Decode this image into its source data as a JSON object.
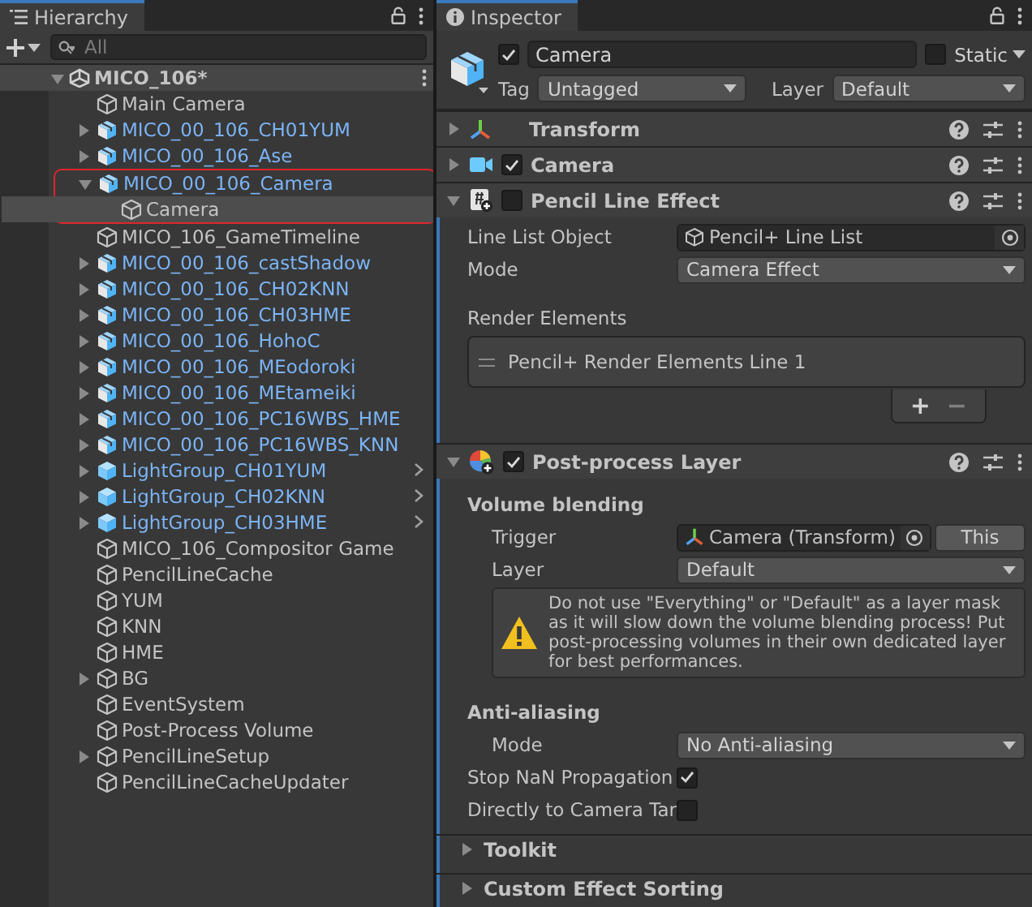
{
  "hierarchy": {
    "tab": "Hierarchy",
    "search": {
      "placeholder": "All"
    },
    "scene": {
      "name": "MICO_106*",
      "expanded": true,
      "children": [
        {
          "name": "Main Camera",
          "kind": "object",
          "selected": false
        },
        {
          "name": "MICO_00_106_CH01YUM",
          "kind": "model",
          "selected": false,
          "expanded": false
        },
        {
          "name": "MICO_00_106_Ase",
          "kind": "model",
          "selected": false,
          "expanded": false
        },
        {
          "name": "MICO_00_106_Camera",
          "kind": "model",
          "selected": false,
          "expanded": true,
          "outlined": true,
          "children": [
            {
              "name": "Camera",
              "kind": "object",
              "selected": true
            }
          ]
        },
        {
          "name": "MICO_106_GameTimeline",
          "kind": "object",
          "selected": false
        },
        {
          "name": "MICO_00_106_castShadow",
          "kind": "model",
          "selected": false,
          "expanded": false
        },
        {
          "name": "MICO_00_106_CH02KNN",
          "kind": "model",
          "selected": false,
          "expanded": false
        },
        {
          "name": "MICO_00_106_CH03HME",
          "kind": "model",
          "selected": false,
          "expanded": false
        },
        {
          "name": "MICO_00_106_HohoC",
          "kind": "model",
          "selected": false,
          "expanded": false
        },
        {
          "name": "MICO_00_106_MEodoroki",
          "kind": "model",
          "selected": false,
          "expanded": false
        },
        {
          "name": "MICO_00_106_MEtameiki",
          "kind": "model",
          "selected": false,
          "expanded": false
        },
        {
          "name": "MICO_00_106_PC16WBS_HME",
          "kind": "model",
          "selected": false,
          "expanded": false
        },
        {
          "name": "MICO_00_106_PC16WBS_KNN",
          "kind": "model",
          "selected": false,
          "expanded": false
        },
        {
          "name": "LightGroup_CH01YUM",
          "kind": "prefab",
          "selected": false,
          "expanded": false
        },
        {
          "name": "LightGroup_CH02KNN",
          "kind": "prefab",
          "selected": false,
          "expanded": false
        },
        {
          "name": "LightGroup_CH03HME",
          "kind": "prefab",
          "selected": false,
          "expanded": false
        },
        {
          "name": "MICO_106_Compositor Game",
          "kind": "object",
          "selected": false
        },
        {
          "name": "PencilLineCache",
          "kind": "object",
          "selected": false
        },
        {
          "name": "YUM",
          "kind": "object",
          "selected": false
        },
        {
          "name": "KNN",
          "kind": "object",
          "selected": false
        },
        {
          "name": "HME",
          "kind": "object",
          "selected": false
        },
        {
          "name": "BG",
          "kind": "object",
          "selected": false,
          "expanded": false
        },
        {
          "name": "EventSystem",
          "kind": "object",
          "selected": false
        },
        {
          "name": "Post-Process Volume",
          "kind": "object",
          "selected": false
        },
        {
          "name": "PencilLineSetup",
          "kind": "object",
          "selected": false,
          "expanded": false
        },
        {
          "name": "PencilLineCacheUpdater",
          "kind": "object",
          "selected": false
        }
      ]
    }
  },
  "inspector": {
    "tab": "Inspector",
    "object": {
      "active": true,
      "name": "Camera",
      "static": false,
      "static_label": "Static",
      "tag_label": "Tag",
      "tag": "Untagged",
      "layer_label": "Layer",
      "layer": "Default"
    },
    "components": [
      {
        "title": "Transform",
        "kind": "transform",
        "expanded": false
      },
      {
        "title": "Camera",
        "kind": "camera",
        "expanded": false,
        "enabled": true
      },
      {
        "title": "Pencil Line Effect",
        "kind": "script",
        "expanded": true,
        "enabled": false,
        "fields": [
          {
            "kind": "gameobject_field",
            "label": "Line List Object",
            "value": "Pencil+ Line List"
          },
          {
            "kind": "dropdown",
            "label": "Mode",
            "value": "Camera Effect"
          },
          {
            "kind": "list",
            "label": "Render Elements",
            "items": [
              "Pencil+ Render Elements Line 1"
            ],
            "add": "+",
            "remove": "−"
          }
        ]
      },
      {
        "title": "Post-process Layer",
        "kind": "postprocess",
        "expanded": true,
        "enabled": true,
        "fields": [
          {
            "kind": "group",
            "label": "Volume blending",
            "fields": [
              {
                "kind": "transform_field",
                "label": "Trigger",
                "value": "Camera (Transform)",
                "button": "This"
              },
              {
                "kind": "dropdown",
                "label": "Layer",
                "value": "Default"
              },
              {
                "kind": "help",
                "text": "Do not use \"Everything\" or \"Default\" as a layer mask as it will slow down the volume blending process! Put post-processing volumes in their own dedicated layer for best performances."
              }
            ]
          },
          {
            "kind": "group",
            "label": "Anti-aliasing",
            "fields": [
              {
                "kind": "dropdown",
                "label": "Mode",
                "value": "No Anti-aliasing"
              }
            ]
          },
          {
            "kind": "toggle",
            "label": "Stop NaN Propagation",
            "checked": true
          },
          {
            "kind": "toggle",
            "label": "Directly to Camera Tar",
            "checked": false
          },
          {
            "kind": "foldout",
            "label": "Toolkit",
            "expanded": false
          },
          {
            "kind": "foldout",
            "label": "Custom Effect Sorting",
            "expanded": false
          }
        ]
      }
    ]
  }
}
